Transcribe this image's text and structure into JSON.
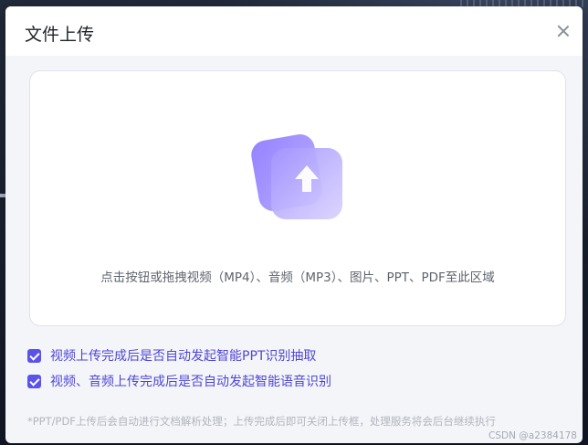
{
  "dialog": {
    "title": "文件上传",
    "close_icon": "close-icon"
  },
  "drop_zone": {
    "illustration_icon": "upload-arrow-icon",
    "hint": "点击按钮或拖拽视频（MP4）、音频（MP3）、图片、PPT、PDF至此区域"
  },
  "options": [
    {
      "label": "视频上传完成后是否自动发起智能PPT识别抽取",
      "checked": true
    },
    {
      "label": "视频、音频上传完成后是否自动发起智能语音识别",
      "checked": true
    }
  ],
  "footnote": "*PPT/PDF上传后会自动进行文档解析处理；上传完成后即可关闭上传框，处理服务将会后台继续执行",
  "watermark": "CSDN @a2384178",
  "colors": {
    "accent": "#5b53e9",
    "accent_text": "#4e46d8",
    "icon_gradient_start": "#9b8cff",
    "icon_gradient_end": "#c9c0ff"
  }
}
